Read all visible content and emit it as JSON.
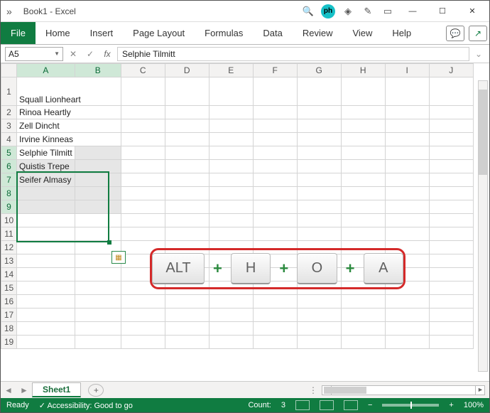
{
  "title": "Book1  -  Excel",
  "ribbon": {
    "file": "File",
    "tabs": [
      "Home",
      "Insert",
      "Page Layout",
      "Formulas",
      "Data",
      "Review",
      "View",
      "Help"
    ]
  },
  "namebox": "A5",
  "formula": "Selphie Tilmitt",
  "columns": [
    "A",
    "B",
    "C",
    "D",
    "E",
    "F",
    "G",
    "H",
    "I",
    "J"
  ],
  "rows": [
    1,
    2,
    3,
    4,
    5,
    6,
    7,
    8,
    9,
    10,
    11,
    12,
    13,
    14,
    15,
    16,
    17,
    18,
    19
  ],
  "cells": {
    "A1": "Squall Lionheart",
    "A2": "Rinoa Heartly",
    "A3": "Zell Dincht",
    "A4": "Irvine Kinneas",
    "A5": "Selphie Tilmitt",
    "A6": "Quistis Trepe",
    "A7": "Seifer Almasy"
  },
  "shortcut": {
    "keys": [
      "ALT",
      "H",
      "O",
      "A"
    ]
  },
  "sheet_tab": "Sheet1",
  "status": {
    "ready": "Ready",
    "accessibility": "Accessibility: Good to go",
    "count_label": "Count:",
    "count_value": "3",
    "zoom": "100%"
  },
  "icons": {
    "search": "🔍",
    "diamond": "◈",
    "wand": "✎",
    "window": "▭",
    "comment": "💬",
    "share": "↗"
  }
}
